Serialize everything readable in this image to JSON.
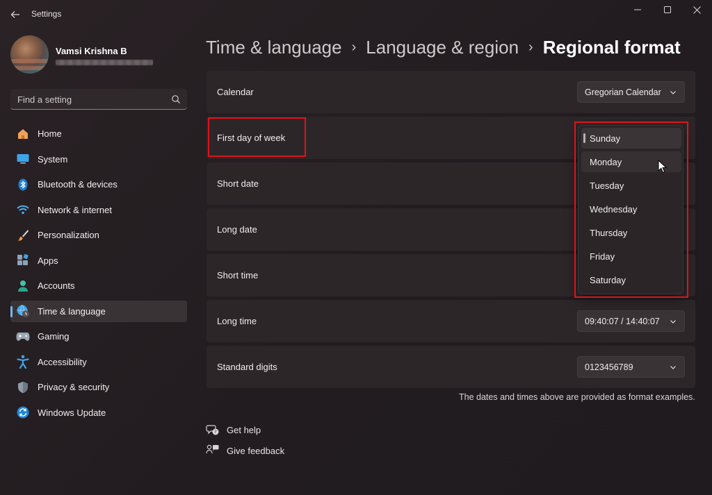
{
  "window": {
    "title": "Settings",
    "back_icon": "arrow-left-icon",
    "minimize_icon": "minimize-icon",
    "maximize_icon": "maximize-icon",
    "close_icon": "close-icon"
  },
  "profile": {
    "name": "Vamsi Krishna B"
  },
  "search": {
    "placeholder": "Find a setting",
    "icon": "search-icon"
  },
  "sidebar": {
    "items": [
      {
        "label": "Home",
        "icon": "home-icon"
      },
      {
        "label": "System",
        "icon": "monitor-icon"
      },
      {
        "label": "Bluetooth & devices",
        "icon": "bluetooth-icon"
      },
      {
        "label": "Network & internet",
        "icon": "wifi-icon"
      },
      {
        "label": "Personalization",
        "icon": "paintbrush-icon"
      },
      {
        "label": "Apps",
        "icon": "apps-icon"
      },
      {
        "label": "Accounts",
        "icon": "person-icon"
      },
      {
        "label": "Time & language",
        "icon": "globe-clock-icon",
        "active": true
      },
      {
        "label": "Gaming",
        "icon": "gamepad-icon"
      },
      {
        "label": "Accessibility",
        "icon": "accessibility-icon"
      },
      {
        "label": "Privacy & security",
        "icon": "shield-icon"
      },
      {
        "label": "Windows Update",
        "icon": "sync-icon"
      }
    ]
  },
  "breadcrumb": {
    "items": [
      "Time & language",
      "Language & region",
      "Regional format"
    ],
    "separator_icon": "chevron-right-icon"
  },
  "settings": {
    "rows": [
      {
        "label": "Calendar",
        "value": "Gregorian Calendar"
      },
      {
        "label": "First day of week",
        "value": ""
      },
      {
        "label": "Short date",
        "value": ""
      },
      {
        "label": "Long date",
        "value": ""
      },
      {
        "label": "Short time",
        "value": ""
      },
      {
        "label": "Long time",
        "value": "09:40:07 / 14:40:07"
      },
      {
        "label": "Standard digits",
        "value": "0123456789"
      }
    ]
  },
  "first_day_dropdown": {
    "options": [
      "Sunday",
      "Monday",
      "Tuesday",
      "Wednesday",
      "Thursday",
      "Friday",
      "Saturday"
    ],
    "selected": "Sunday",
    "hovered": "Monday"
  },
  "footnote": "The dates and times above are provided as format examples.",
  "links": [
    {
      "label": "Get help",
      "icon": "help-chat-icon"
    },
    {
      "label": "Give feedback",
      "icon": "feedback-icon"
    }
  ],
  "colors": {
    "accent": "#76b9ed",
    "highlight_box": "#e0131b",
    "background": "#221c20",
    "card": "#2d2629"
  }
}
